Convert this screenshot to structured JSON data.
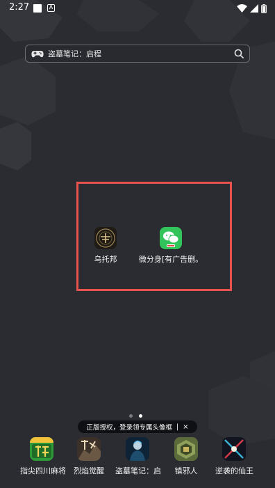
{
  "status_bar": {
    "time": "2:27",
    "notif_badge": "A"
  },
  "search": {
    "text": "盗墓笔记：启程"
  },
  "folder": {
    "apps": [
      {
        "label": "乌托邦"
      },
      {
        "label": "微分身[有广告删。"
      }
    ]
  },
  "tooltip": {
    "text": "正版授权，登录领专属头像框",
    "separator": "|",
    "close": "×"
  },
  "dock": {
    "items": [
      {
        "label": "指尖四川麻将"
      },
      {
        "label": "烈焰觉醒"
      },
      {
        "label": "盗墓笔记：启"
      },
      {
        "label": "镇邪人"
      },
      {
        "label": "逆袭的仙王"
      }
    ]
  },
  "colors": {
    "background": "#2a2c31",
    "highlight": "#e8534f",
    "wechat_green": "#33c35b"
  }
}
